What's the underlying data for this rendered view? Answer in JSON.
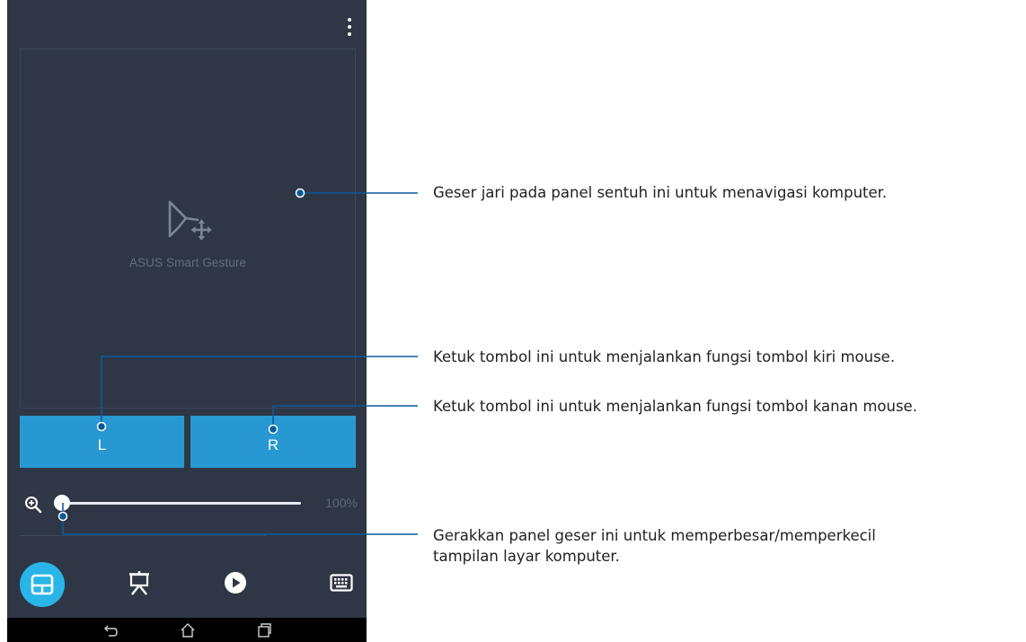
{
  "touchpad": {
    "label": "ASUS Smart Gesture"
  },
  "buttons": {
    "left": "L",
    "right": "R"
  },
  "zoom": {
    "value_text": "100%",
    "level_fraction": 0.0
  },
  "tabs": [
    "touchpad-icon",
    "presentation-icon",
    "play-icon",
    "keyboard-icon"
  ],
  "colors": {
    "screen_bg": "#2f3746",
    "button_blue": "#2898d3",
    "active_tab": "#29b5e8",
    "callout_line": "#0a5a9c"
  },
  "callouts": {
    "touchpad": "Geser jari pada panel sentuh ini untuk menavigasi komputer.",
    "left_button": "Ketuk tombol ini untuk menjalankan fungsi tombol kiri mouse.",
    "right_button": "Ketuk tombol ini untuk menjalankan fungsi tombol kanan mouse.",
    "zoom_line1": "Gerakkan panel geser ini untuk memperbesar/memperkecil",
    "zoom_line2": "tampilan layar komputer."
  }
}
